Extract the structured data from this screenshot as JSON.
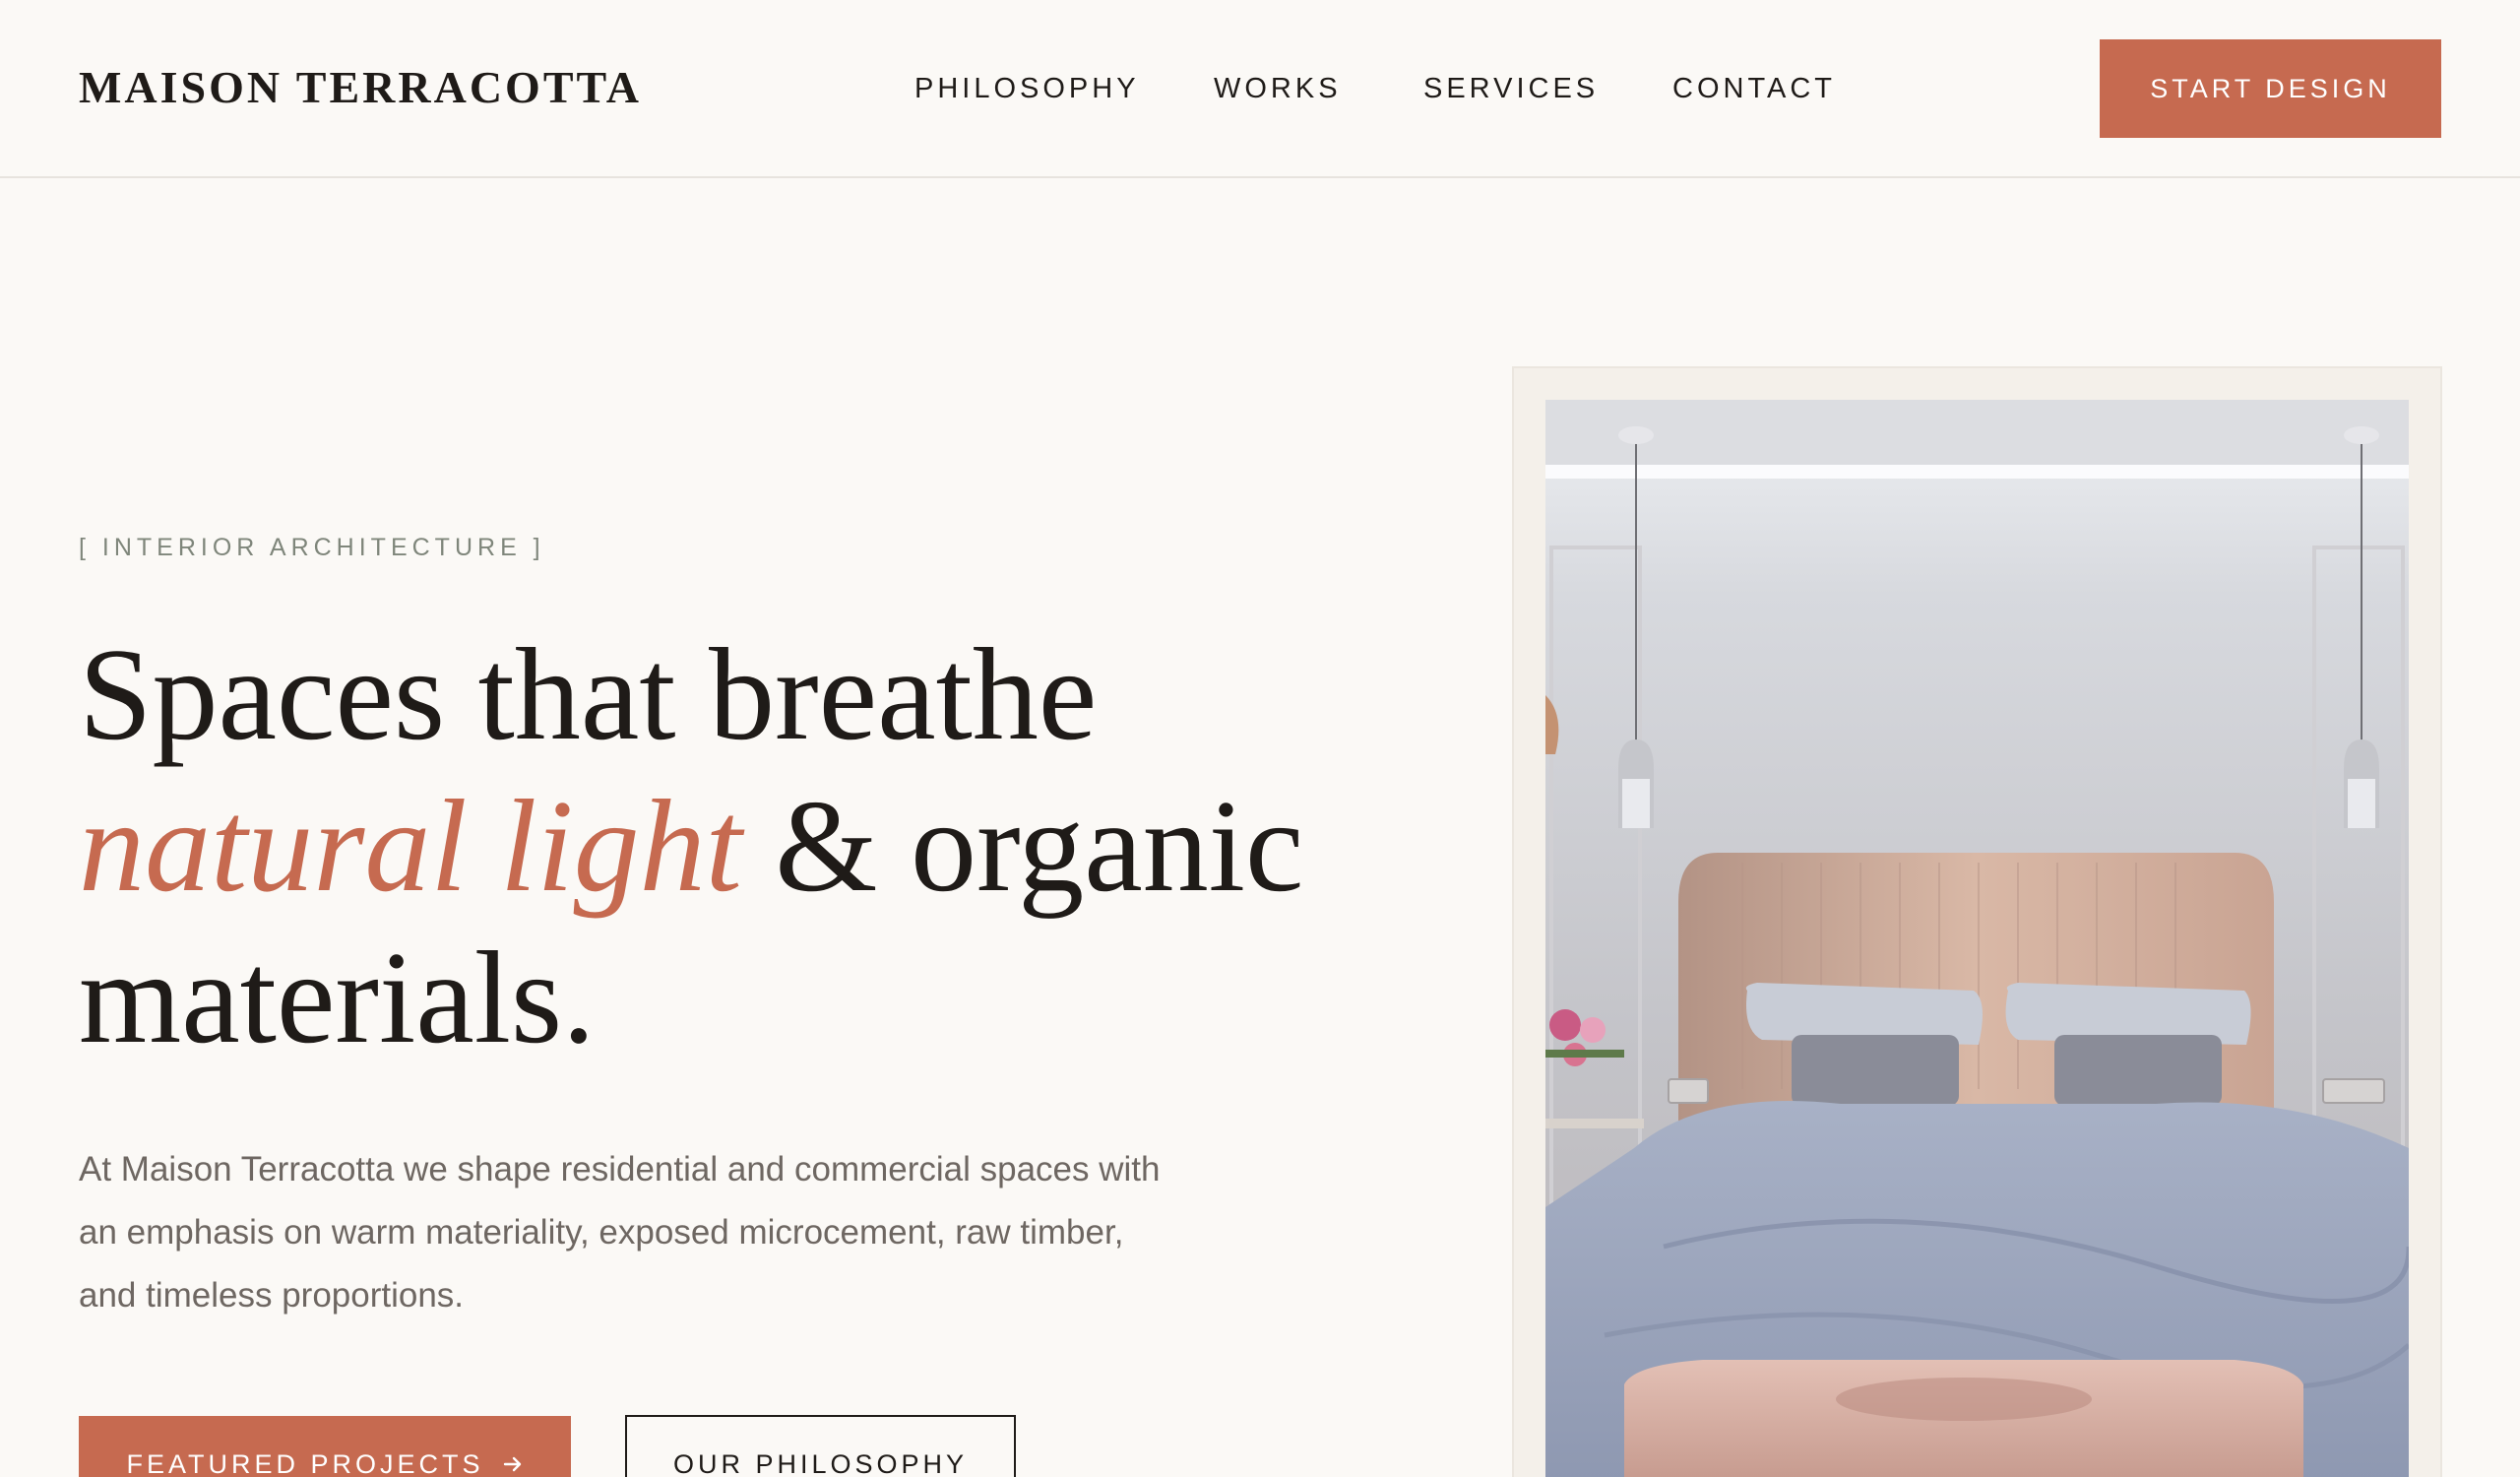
{
  "brand": {
    "name": "MAISON TERRACOTTA"
  },
  "nav": {
    "items": [
      "PHILOSOPHY",
      "WORKS",
      "SERVICES",
      "CONTACT"
    ]
  },
  "header": {
    "cta_label": "START DESIGN"
  },
  "hero": {
    "eyebrow": "[ INTERIOR ARCHITECTURE ]",
    "headline_part1": "Spaces that breathe",
    "headline_accent": "natural light",
    "headline_part2": "& organic materials.",
    "body": "At Maison Terracotta we shape residential and commercial spaces with an emphasis on warm materiality, exposed microcement, raw timber, and timeless proportions.",
    "primary_button": "FEATURED PROJECTS",
    "primary_button_icon": "arrow-right-icon",
    "secondary_button": "OUR PHILOSOPHY",
    "image_subject": "bedroom-photo"
  },
  "colors": {
    "accent": "#c66a50",
    "background": "#fbf9f6",
    "text": "#1f1b18",
    "muted": "#6e6762",
    "eyebrow": "#7f867b"
  }
}
